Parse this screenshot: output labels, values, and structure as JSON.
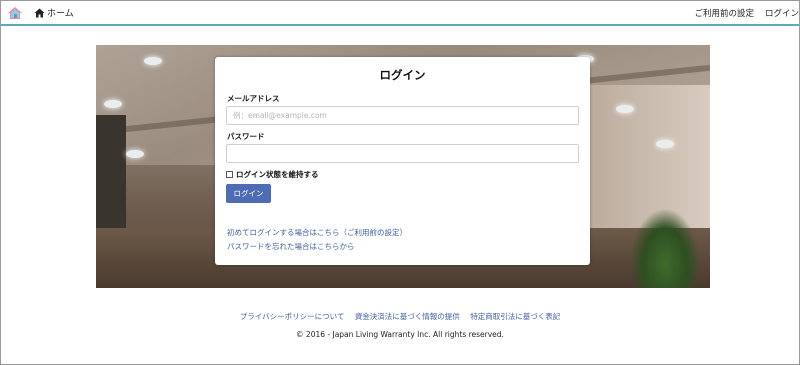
{
  "header": {
    "home_label": "ホーム",
    "nav_settings": "ご利用前の設定",
    "nav_login": "ログイン",
    "accent_color": "#5ca9b8"
  },
  "login": {
    "title": "ログイン",
    "email_label": "メールアドレス",
    "email_placeholder": "例：email@example.com",
    "email_value": "",
    "password_label": "パスワード",
    "password_value": "",
    "remember_label": "ログイン状態を維持する",
    "remember_checked": false,
    "submit_label": "ログイン",
    "first_login_link": "初めてログインする場合はこちら（ご利用前の設定）",
    "forgot_password_link": "パスワードを忘れた場合はこちらから",
    "button_color": "#4d6cb3"
  },
  "footer": {
    "links": [
      "プライバシーポリシーについて",
      "資金決済法に基づく情報の提供",
      "特定商取引法に基づく表記"
    ],
    "copyright": "© 2016 - Japan Living Warranty Inc. All rights reserved."
  },
  "icons": {
    "logo": "house-logo-icon",
    "home": "home-icon"
  }
}
